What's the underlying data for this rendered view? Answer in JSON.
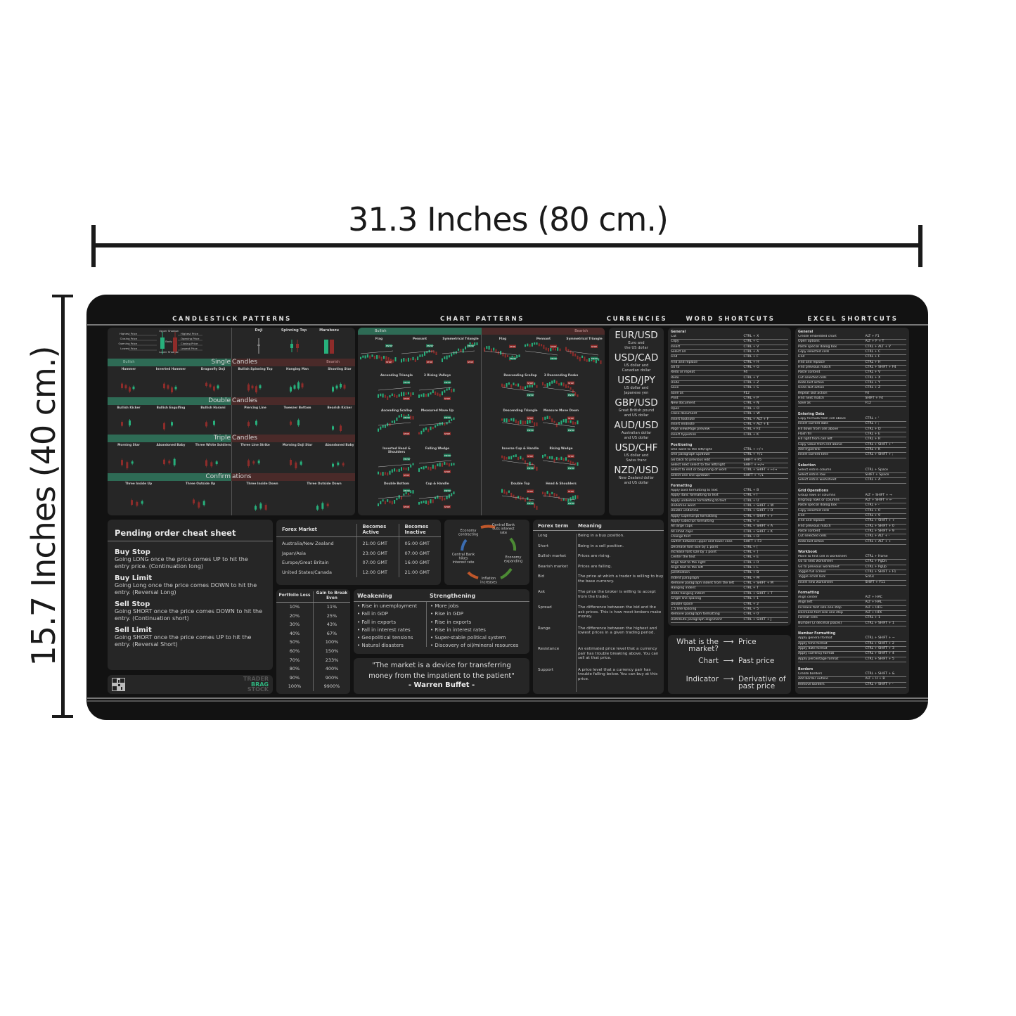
{
  "dimensions": {
    "width_label": "31.3 Inches (80 cm.)",
    "height_label": "15.7 Inches (40 cm.)"
  },
  "headers": {
    "candlestick": "CANDLESTICK PATTERNS",
    "chart": "CHART PATTERNS",
    "currencies": "CURRENCIES",
    "word": "WORD SHORTCUTS",
    "excel": "EXCEL SHORTCUTS"
  },
  "colors": {
    "bullish": "#27b07c",
    "bearish": "#8e2c2a",
    "mat": "#121212",
    "panel": "#262626"
  },
  "candlestick": {
    "anatomy": {
      "left": [
        "Highest Price",
        "Closing Price",
        "Opening Price",
        "Lowest Price"
      ],
      "center": [
        "Upper Shadow",
        "Body",
        "Lower Shadow"
      ],
      "right": [
        "Highest Price",
        "Opening Price",
        "Closing Price",
        "Lowest Price"
      ]
    },
    "basic": [
      "Doji",
      "Spinning Top",
      "Marubozu"
    ],
    "bullish_label": "Bullish",
    "bearish_label": "Bearish",
    "sections": [
      {
        "left": "Single",
        "right": "Candles",
        "bullish": [
          "Hammer",
          "Inverted Hammer",
          "Dragonfly Doji",
          "Bullish Spinning Top"
        ],
        "bearish": [
          "Hanging Man",
          "Shooting Star",
          "Gravestone Doji",
          "Bearish Spinning Top"
        ]
      },
      {
        "left": "Double",
        "right": "Candles",
        "bullish": [
          "Bullish Kicker",
          "Bullish Engulfing",
          "Bullish Harami",
          "Piercing Line",
          "Tweezer Bottom"
        ],
        "bearish": [
          "Bearish Kicker",
          "Bearish Engulfing",
          "Bearish Harami",
          "Dark Cloud Cover",
          "Tweezer Top"
        ]
      },
      {
        "left": "Triple",
        "right": "Candles",
        "bullish": [
          "Morning Star",
          "Abandoned Baby",
          "Three White Soldiers",
          "Three Line Strike",
          "Morning Doji Star"
        ],
        "bearish": [
          "Abandoned Baby",
          "Three Black Crows",
          "Evening Doji Star",
          "Evening Star"
        ]
      },
      {
        "left": "Confirm",
        "right": "ations",
        "bullish": [
          "Three Inside Up",
          "Three Outside Up"
        ],
        "bearish": [
          "Three Inside Down",
          "Three Outside Down"
        ]
      }
    ]
  },
  "chart_patterns": {
    "bullish_label": "Bullish",
    "bearish_label": "Bearish",
    "stop_tag": "STOP",
    "entry_tag": "ENTRY",
    "bullish": [
      "Flag",
      "Pennant",
      "Symmetrical Triangle",
      "Ascending Triangle",
      "3 Rising Valleys",
      "Ascending Scallop",
      "Measured Move Up",
      "Inverted Head & Shoulders",
      "Falling Wedge",
      "Double Bottom",
      "Cup & Handle"
    ],
    "bearish": [
      "Flag",
      "Pennant",
      "Symmetrical Triangle",
      "Descending Scallop",
      "3 Descending Peaks",
      "Descending Triangle",
      "Measure Move Down",
      "Inverse Cup & Handle",
      "Rising Wedge",
      "Double Top",
      "Head & Shoulders"
    ]
  },
  "currencies": [
    {
      "pair": "EUR/USD",
      "desc": "Euro and\nthe US dollar"
    },
    {
      "pair": "USD/CAD",
      "desc": "US dollar and\nCanadian dollar"
    },
    {
      "pair": "USD/JPY",
      "desc": "US dollar and\nJapanese yen"
    },
    {
      "pair": "GBP/USD",
      "desc": "Great British pound\nand US dollar"
    },
    {
      "pair": "AUD/USD",
      "desc": "Australian dollar\nand US dollar"
    },
    {
      "pair": "USD/CHF",
      "desc": "US dollar and\nSwiss franc"
    },
    {
      "pair": "NZD/USD",
      "desc": "New Zealand dollar\nand US dollar"
    }
  ],
  "word_shortcuts": [
    {
      "title": "General",
      "items": [
        [
          "Cut",
          "CTRL + X"
        ],
        [
          "Copy",
          "CTRL + C"
        ],
        [
          "Insert",
          "CTRL + V"
        ],
        [
          "Select all",
          "CTRL + A"
        ],
        [
          "Find",
          "CTRL + F"
        ],
        [
          "Find and replace",
          "CTRL + H"
        ],
        [
          "Go to",
          "CTRL + G"
        ],
        [
          "Redo or repeat",
          "F4"
        ],
        [
          "Redo",
          "CTRL + Y"
        ],
        [
          "Undo",
          "CTRL + Z"
        ],
        [
          "Save",
          "CTRL + S"
        ],
        [
          "Save as",
          "F12"
        ],
        [
          "Print",
          "CTRL + P"
        ],
        [
          "New document",
          "CTRL + N"
        ],
        [
          "Open",
          "CTRL + O"
        ],
        [
          "Close document",
          "CTRL + W"
        ],
        [
          "Insert footnote",
          "CTRL + ALT + F"
        ],
        [
          "Insert endnote",
          "CTRL + ALT + E"
        ],
        [
          "Page view/Page preview",
          "CTRL + F2"
        ],
        [
          "Insert hyperlink",
          "CTRL + K"
        ]
      ]
    },
    {
      "title": "Positioning",
      "items": [
        [
          "One word to the left/right",
          "CTRL + ←/→"
        ],
        [
          "One paragraph up/down",
          "CTRL + ↑/↓"
        ],
        [
          "Go back to previous edit",
          "SHIFT + F5"
        ],
        [
          "Select next select to the left/right",
          "SHIFT + ←/→"
        ],
        [
          "Select to end or beginning of word",
          "CTRL + SHIFT + ←/→"
        ],
        [
          "Select one line up/down",
          "SHIFT + ↑/↓"
        ]
      ]
    },
    {
      "title": "Formatting",
      "items": [
        [
          "Apply bold formatting to text",
          "CTRL + B"
        ],
        [
          "Apply italic formatting to text",
          "CTRL + I"
        ],
        [
          "Apply underline formatting to text",
          "CTRL + U"
        ],
        [
          "Underline word",
          "CTRL + SHIFT + W"
        ],
        [
          "Double underline",
          "CTRL + SHIFT + D"
        ],
        [
          "Apply superscript formatting",
          "CTRL + SHIFT + +"
        ],
        [
          "Apply subscript formatting",
          "CTRL + ="
        ],
        [
          "All large caps",
          "CTRL + SHIFT + A"
        ],
        [
          "All small caps",
          "CTRL + SHIFT + K"
        ],
        [
          "Change font",
          "CTRL + D"
        ],
        [
          "Switch between upper and lower case",
          "SHIFT + F3"
        ],
        [
          "Decrease font size by 1 point",
          "CTRL + ["
        ],
        [
          "Increase font size by 1 point",
          "CTRL + ]"
        ],
        [
          "Center the text",
          "CTRL + E"
        ],
        [
          "Align text to the right",
          "CTRL + R"
        ],
        [
          "Align text to the left",
          "CTRL + L"
        ],
        [
          "Justification",
          "CTRL + B"
        ],
        [
          "Indent paragraph",
          "CTRL + M"
        ],
        [
          "Remove paragraph indent from the left",
          "CTRL + SHIFT + M"
        ],
        [
          "Hanging indent",
          "CTRL + T"
        ],
        [
          "Undo hanging indent",
          "CTRL + SHIFT + T"
        ],
        [
          "Single line spacing",
          "CTRL + 1"
        ],
        [
          "Double space",
          "CTRL + 2"
        ],
        [
          "1.5 line spacing",
          "CTRL + 5"
        ],
        [
          "Remove paragraph formatting",
          "CTRL + 0"
        ],
        [
          "Distribute paragraph alignment",
          "CTRL + SHIFT + J"
        ]
      ]
    }
  ],
  "excel_shortcuts": [
    {
      "title": "General",
      "items": [
        [
          "Create embedded chart",
          "ALT + F1"
        ],
        [
          "Open options",
          "ALT + F + T"
        ],
        [
          "Paste special dialog box",
          "CTRL + ALT + V"
        ],
        [
          "Copy selected cells",
          "CTRL + C"
        ],
        [
          "Find",
          "CTRL + F"
        ],
        [
          "Find and replace",
          "CTRL + H"
        ],
        [
          "Find previous match",
          "CTRL + SHIFT + F4"
        ],
        [
          "Paste content",
          "CTRL + V"
        ],
        [
          "Cut selected cells",
          "CTRL + X"
        ],
        [
          "Redo last action",
          "CTRL + Y"
        ],
        [
          "Undo last action",
          "CTRL + Z"
        ],
        [
          "Repeat last action",
          "F4"
        ],
        [
          "Find next match",
          "SHIFT + F4"
        ],
        [
          "Save as",
          "F12"
        ]
      ]
    },
    {
      "title": "Entering Data",
      "items": [
        [
          "Copy formula from cell above",
          "CTRL + '"
        ],
        [
          "Insert current date",
          "CTRL + ;"
        ],
        [
          "Fill down from cell above",
          "CTRL + D"
        ],
        [
          "Flash fill",
          "CTRL + E"
        ],
        [
          "Fill right from cell left",
          "CTRL + R"
        ],
        [
          "Copy value from cell above",
          "CTRL + SHIFT + '"
        ],
        [
          "Add hyperlink",
          "CTRL + K"
        ],
        [
          "Insert current time",
          "CTRL + SHIFT + ;"
        ]
      ]
    },
    {
      "title": "Selection",
      "items": [
        [
          "Select entire column",
          "CTRL + Space"
        ],
        [
          "Select entire row",
          "SHIFT + Space"
        ],
        [
          "Select entire worksheet",
          "CTRL + A"
        ]
      ]
    },
    {
      "title": "Grid Operations",
      "items": [
        [
          "Group rows or columns",
          "ALT + SHIFT + →"
        ],
        [
          "Ungroup rows or columns",
          "ALT + SHIFT + ←"
        ],
        [
          "Paste special dialog box",
          "CTRL + -"
        ],
        [
          "Copy selected cells",
          "CTRL + 0"
        ],
        [
          "Find",
          "CTRL + 9"
        ],
        [
          "Find and replace",
          "CTRL + SHIFT + +"
        ],
        [
          "Find previous match",
          "CTRL + SHIFT + 0"
        ],
        [
          "Paste content",
          "CTRL + SHIFT + 9"
        ],
        [
          "Cut selected cells",
          "CTRL + ALT + -"
        ],
        [
          "Redo last action",
          "CTRL + ALT + +"
        ]
      ]
    },
    {
      "title": "Workbook",
      "items": [
        [
          "Move to first cell in worksheet",
          "CTRL + Home"
        ],
        [
          "Go to next worksheet",
          "CTRL + PgDn"
        ],
        [
          "Go to previous worksheet",
          "CTRL + PgUp"
        ],
        [
          "Toggle full screen",
          "CTRL + SHIFT + F1"
        ],
        [
          "Toggle scroll lock",
          "ScrLk"
        ],
        [
          "Insert new worksheet",
          "SHIFT + F11"
        ]
      ]
    },
    {
      "title": "Formatting",
      "items": [
        [
          "Align center",
          "ALT + HAC"
        ],
        [
          "Align left",
          "ALT + HAL"
        ],
        [
          "Increase font size one step",
          "ALT + HFG"
        ],
        [
          "Decrease font size one step",
          "ALT + HFK"
        ],
        [
          "Format cells",
          "CTRL + 1"
        ],
        [
          "Number (2 decimal places)",
          "CTRL + SHIFT + 1"
        ]
      ]
    },
    {
      "title": "Number Formatting",
      "items": [
        [
          "Apply general format",
          "CTRL + SHIFT + ~"
        ],
        [
          "Apply time format",
          "CTRL + SHIFT + 2"
        ],
        [
          "Apply date format",
          "CTRL + SHIFT + 3"
        ],
        [
          "Apply currency format",
          "CTRL + SHIFT + 4"
        ],
        [
          "Apply percentage format",
          "CTRL + SHIFT + 5"
        ]
      ]
    },
    {
      "title": "Borders",
      "items": [
        [
          "Create borders",
          "CTRL + SHIFT + &"
        ],
        [
          "Add border outline",
          "ALT + H + B"
        ],
        [
          "Remove borders",
          "CTRL + SHIFT + -"
        ]
      ]
    }
  ],
  "pending": {
    "title": "Pending order cheat sheet",
    "items": [
      {
        "name": "Buy Stop",
        "desc": "Going LONG once the price comes UP to hit the entry price. (Continuation long)"
      },
      {
        "name": "Buy Limit",
        "desc": "Going Long once the price comes DOWN to hit the entry. (Reversal Long)"
      },
      {
        "name": "Sell Stop",
        "desc": "Going SHORT once the price comes DOWN to hit the entry. (Continuation short)"
      },
      {
        "name": "Sell Limit",
        "desc": "Going SHORT once the price comes UP to hit the entry. (Reversal Short)"
      }
    ]
  },
  "logo": {
    "line1": "TRADER",
    "line2": "BRAG",
    "line3": "STOCK"
  },
  "forex_market": {
    "headers": [
      "Forex Market",
      "Becomes Active",
      "Becomes Inactive"
    ],
    "rows": [
      [
        "Australia/New Zealand",
        "21:00 GMT",
        "05:00 GMT"
      ],
      [
        "Japan/Asia",
        "23:00 GMT",
        "07:00 GMT"
      ],
      [
        "Europe/Great Britain",
        "07:00 GMT",
        "16:00 GMT"
      ],
      [
        "United States/Canada",
        "12:00 GMT",
        "21:00 GMT"
      ]
    ]
  },
  "cycle": [
    "Central Bank cuts interest rate",
    "Economy expanding",
    "Inflation increases",
    "Central Bank hikes interest rate",
    "Economy contracting"
  ],
  "portfolio": {
    "headers": [
      "Portfolio Loss",
      "Gain to Break Even"
    ],
    "rows": [
      [
        "10%",
        "11%"
      ],
      [
        "20%",
        "25%"
      ],
      [
        "30%",
        "43%"
      ],
      [
        "40%",
        "67%"
      ],
      [
        "50%",
        "100%"
      ],
      [
        "60%",
        "150%"
      ],
      [
        "70%",
        "233%"
      ],
      [
        "80%",
        "400%"
      ],
      [
        "90%",
        "900%"
      ],
      [
        "100%",
        "9900%"
      ]
    ]
  },
  "economy": {
    "weakening_title": "Weakening",
    "strengthening_title": "Strengthening",
    "weakening": [
      "Rise in unemployment",
      "Fall in GDP",
      "Fall in exports",
      "Fall in interest rates",
      "Geopolitical tensions",
      "Natural disasters"
    ],
    "strengthening": [
      "More jobs",
      "Rise in GDP",
      "Rise in exports",
      "Rise in interest rates",
      "Super-stable political system",
      "Discovery of oil/mineral resources"
    ]
  },
  "quote": {
    "text": "\"The market is a device for transferring money from the impatient to the patient\"",
    "author": "- Warren Buffet -"
  },
  "forex_terms": {
    "headers": [
      "Forex term",
      "Meaning"
    ],
    "rows": [
      [
        "Long",
        "Being in a buy position."
      ],
      [
        "Short",
        "Being in a sell position."
      ],
      [
        "Bullish market",
        "Prices are rising."
      ],
      [
        "Bearish market",
        "Prices are falling."
      ],
      [
        "Bid",
        "The price at which a trader is willing to buy the base currency."
      ],
      [
        "Ask",
        "The price the broker is willing to accept from the trader."
      ],
      [
        "Spread",
        "The difference between the bid and the ask prices. This is how most brokers make money."
      ],
      [
        "Range",
        "The difference between the highest and lowest prices in a given trading period."
      ],
      [
        "Resistance",
        "An estimated price level that a currency pair has trouble breaking above. You can sell at that price."
      ],
      [
        "Support",
        "A price level that a currency pair has trouble falling below. You can buy at this price."
      ]
    ]
  },
  "market_def": [
    [
      "What is the market?",
      "Price"
    ],
    [
      "Chart",
      "Past price"
    ],
    [
      "Indicator",
      "Derivative of past price"
    ]
  ]
}
